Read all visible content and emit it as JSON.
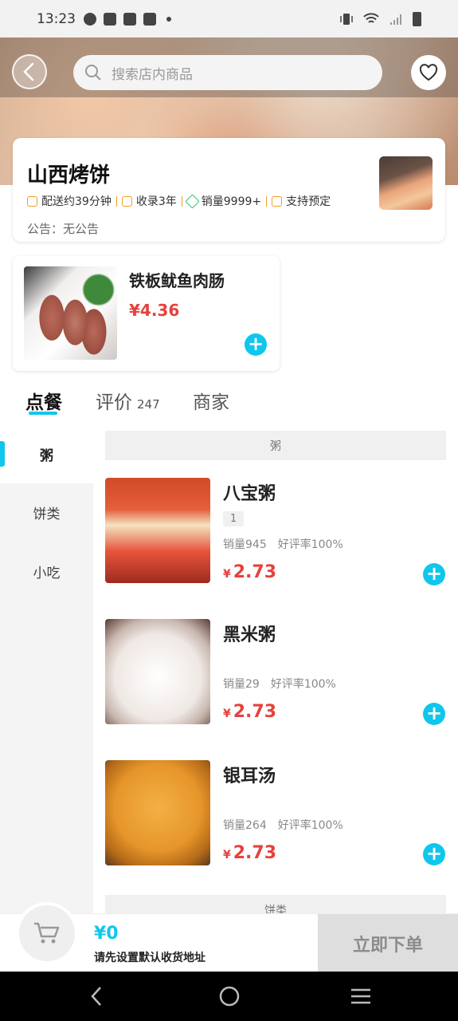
{
  "status_bar": {
    "time": "13:23"
  },
  "search": {
    "placeholder": "搜索店内商品"
  },
  "shop": {
    "name": "山西烤饼",
    "tags": [
      "配送约39分钟",
      "收录3年",
      "销量9999+",
      "支持预定"
    ],
    "notice": "公告：无公告"
  },
  "featured": {
    "name": "铁板鱿鱼肉肠",
    "price": "¥4.36"
  },
  "tabs": [
    {
      "label": "点餐"
    },
    {
      "label": "评价",
      "count": "247"
    },
    {
      "label": "商家"
    }
  ],
  "sidebar": {
    "items": [
      "粥",
      "饼类",
      "小吃"
    ]
  },
  "categories": {
    "zhou": "粥",
    "bing": "饼类"
  },
  "items": [
    {
      "name": "八宝粥",
      "badge": "1",
      "sales": "销量945",
      "rating": "好评率100%",
      "currency": "¥",
      "price": "2.73"
    },
    {
      "name": "黑米粥",
      "sales": "销量29",
      "rating": "好评率100%",
      "currency": "¥",
      "price": "2.73"
    },
    {
      "name": "银耳汤",
      "sales": "销量264",
      "rating": "好评率100%",
      "currency": "¥",
      "price": "2.73"
    }
  ],
  "cart": {
    "total": "¥0",
    "hint": "请先设置默认收货地址",
    "order_label": "立即下单"
  },
  "colors": {
    "accent": "#10c6ec",
    "price": "#e6413d",
    "tag_orange": "#f0a020",
    "tag_green": "#2bbf6a"
  },
  "icons": [
    "back-icon",
    "search-icon",
    "heart-icon",
    "clock-icon",
    "receipt-icon",
    "tag-icon",
    "calendar-icon",
    "plus-icon",
    "cart-icon",
    "nav-back-icon",
    "nav-home-icon",
    "nav-menu-icon"
  ]
}
